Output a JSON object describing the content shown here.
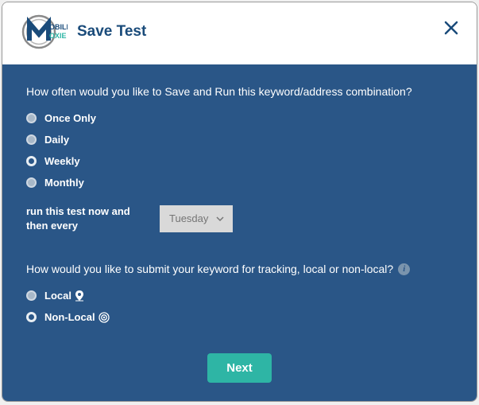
{
  "header": {
    "brand_top": "OBILE",
    "brand_bottom": "OXIE",
    "title": "Save Test"
  },
  "frequency": {
    "question": "How often would you like to Save and Run this keyword/address combination?",
    "options": [
      "Once Only",
      "Daily",
      "Weekly",
      "Monthly"
    ],
    "selected": "Weekly",
    "schedule_label": "run this test now and then every",
    "day": "Tuesday"
  },
  "tracking": {
    "question": "How would you like to submit your keyword for tracking, local or non-local?",
    "options": [
      "Local",
      "Non-Local"
    ],
    "selected": "Non-Local"
  },
  "buttons": {
    "next": "Next"
  }
}
